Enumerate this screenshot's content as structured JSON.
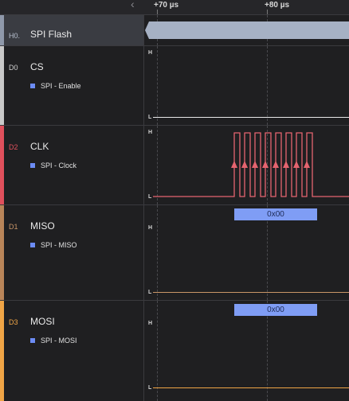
{
  "timeline": {
    "chevron": "‹",
    "labels": [
      "+70 µs",
      "+80 µs"
    ]
  },
  "rows": {
    "spi": {
      "index": "H0.",
      "name": "SPI Flash"
    },
    "cs": {
      "index": "D0",
      "name": "CS",
      "analyzer": "SPI - Enable",
      "high": "H",
      "low": "L",
      "stripe": "#c9c9c9"
    },
    "clk": {
      "index": "D2",
      "name": "CLK",
      "analyzer": "SPI - Clock",
      "high": "H",
      "low": "L",
      "stripe": "#e0505c",
      "pulse_count": 8
    },
    "miso": {
      "index": "D1",
      "name": "MISO",
      "analyzer": "SPI - MISO",
      "high": "H",
      "low": "L",
      "stripe": "#b98559",
      "value": "0x00"
    },
    "mosi": {
      "index": "D3",
      "name": "MOSI",
      "analyzer": "SPI - MOSI",
      "high": "H",
      "low": "L",
      "stripe": "#f0a546",
      "value": "0x00"
    }
  },
  "colors": {
    "cs_wave": "#e9e9e9",
    "clk_wave": "#e5646f",
    "miso_wave": "#c99668",
    "mosi_wave": "#f0a546",
    "packet": "#7f9df5",
    "analyzer": "#6c8cf5"
  }
}
